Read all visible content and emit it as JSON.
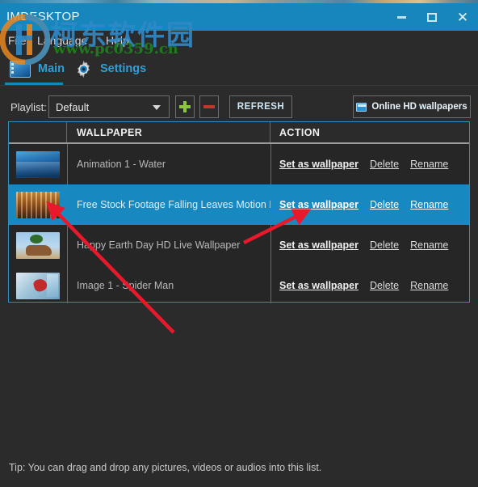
{
  "window": {
    "title": "IMDESKTOP",
    "minimize_label": "Minimize",
    "maximize_label": "Maximize",
    "close_label": "Close"
  },
  "menu": {
    "items": [
      {
        "label": "File"
      },
      {
        "label": "Language"
      },
      {
        "label": "Help"
      }
    ]
  },
  "tabs": [
    {
      "label": "Main",
      "icon": "monitor-icon",
      "active": true
    },
    {
      "label": "Settings",
      "icon": "gear-icon",
      "active": false
    }
  ],
  "toolbar": {
    "playlist_label": "Playlist:",
    "playlist_value": "Default",
    "playlist_options": [
      "Default"
    ],
    "add_label": "+",
    "remove_label": "−",
    "refresh_label": "REFRESH",
    "online_label": "Online HD wallpapers"
  },
  "table": {
    "headers": [
      "",
      "WALLPAPER",
      "ACTION"
    ],
    "actions": {
      "set": "Set as wallpaper",
      "delete": "Delete",
      "rename": "Rename"
    },
    "rows": [
      {
        "name": "Animation 1 - Water",
        "thumb": "t-water",
        "selected": false
      },
      {
        "name": "Free Stock Footage Falling Leaves Motion Backg",
        "thumb": "t-leaves",
        "selected": true
      },
      {
        "name": "Happy Earth Day HD Live Wallpaper",
        "thumb": "t-earth",
        "selected": false
      },
      {
        "name": "Image 1 - Spider Man",
        "thumb": "t-spider",
        "selected": false
      }
    ]
  },
  "footer": {
    "tip": "Tip: You can drag and drop any pictures, videos or audios into this list."
  },
  "watermark": {
    "chinese": "柯东软件园",
    "url": "www.pc0359.cn"
  },
  "colors": {
    "titlebar": "#1786bd",
    "selection": "#1789c0",
    "accent_text": "#2f9fd6",
    "background": "#2b2b2b",
    "table_border": "#2e8ec0",
    "add_green": "#8cc63e",
    "remove_red": "#c0392b",
    "annotation_red": "#e8192c"
  }
}
